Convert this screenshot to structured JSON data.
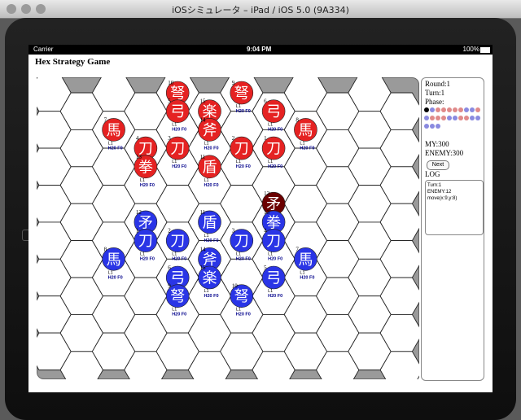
{
  "window_title": "iOSシミュレータ – iPad / iOS 5.0 (9A334)",
  "status": {
    "carrier": "Carrier",
    "time": "9:04 PM",
    "battery": "100%"
  },
  "app_title": "Hex Strategy Game",
  "sidebar": {
    "round": "Round:1",
    "turn": "Turn:1",
    "phase": "Phase:",
    "my": "MY:300",
    "enemy": "ENEMY:300",
    "next": "Next",
    "log_label": "LOG",
    "log_lines": [
      "Turn:1",
      "ENEMY:12",
      "move(x:9,y:8)"
    ]
  },
  "colors": {
    "red": "#e52222",
    "blue": "#2a35e6",
    "dark": "#6b0000",
    "board_bg": "#9a9a9a"
  },
  "phase_dots": [
    "dark",
    "blue",
    "red",
    "red",
    "red",
    "red",
    "red",
    "blue",
    "blue",
    "red",
    "blue",
    "red",
    "red",
    "red",
    "blue",
    "blue",
    "red",
    "red",
    "blue",
    "blue",
    "blue",
    "blue",
    "blue"
  ],
  "unit_stat": {
    "level": "L1",
    "hp": "H20 F0"
  },
  "units": [
    {
      "col": 4,
      "row": 0,
      "side": "red",
      "kanji": "弩",
      "num": "10"
    },
    {
      "col": 6,
      "row": 0,
      "side": "red",
      "kanji": "弩",
      "num": "9"
    },
    {
      "col": 4,
      "row": 1,
      "side": "red",
      "kanji": "弓",
      "num": "5"
    },
    {
      "col": 5,
      "row": 1,
      "side": "red",
      "kanji": "楽",
      "num": "15"
    },
    {
      "col": 7,
      "row": 1,
      "side": "red",
      "kanji": "弓",
      "num": "6"
    },
    {
      "col": 2,
      "row": 2,
      "side": "red",
      "kanji": "馬",
      "num": "7"
    },
    {
      "col": 5,
      "row": 2,
      "side": "red",
      "kanji": "斧",
      "num": "14"
    },
    {
      "col": 8,
      "row": 2,
      "side": "red",
      "kanji": "馬",
      "num": "8"
    },
    {
      "col": 3,
      "row": 3,
      "side": "red",
      "kanji": "刀",
      "num": "4"
    },
    {
      "col": 4,
      "row": 3,
      "side": "red",
      "kanji": "刀",
      "num": "3"
    },
    {
      "col": 6,
      "row": 3,
      "side": "red",
      "kanji": "刀",
      "num": "2"
    },
    {
      "col": 7,
      "row": 3,
      "side": "red",
      "kanji": "刀",
      "num": "1"
    },
    {
      "col": 3,
      "row": 4,
      "side": "red",
      "kanji": "拳",
      "num": "13"
    },
    {
      "col": 5,
      "row": 4,
      "side": "red",
      "kanji": "盾",
      "num": "11"
    },
    {
      "col": 7,
      "row": 6,
      "side": "dark",
      "kanji": "矛",
      "num": "12"
    },
    {
      "col": 3,
      "row": 7,
      "side": "blue",
      "kanji": "矛",
      "num": "12"
    },
    {
      "col": 5,
      "row": 7,
      "side": "blue",
      "kanji": "盾",
      "num": "11"
    },
    {
      "col": 7,
      "row": 7,
      "side": "blue",
      "kanji": "拳",
      "num": "13"
    },
    {
      "col": 3,
      "row": 8,
      "side": "blue",
      "kanji": "刀",
      "num": "1"
    },
    {
      "col": 4,
      "row": 8,
      "side": "blue",
      "kanji": "刀",
      "num": "2"
    },
    {
      "col": 6,
      "row": 8,
      "side": "blue",
      "kanji": "刀",
      "num": "3"
    },
    {
      "col": 7,
      "row": 8,
      "side": "blue",
      "kanji": "刀",
      "num": "4"
    },
    {
      "col": 2,
      "row": 9,
      "side": "blue",
      "kanji": "馬",
      "num": "8"
    },
    {
      "col": 5,
      "row": 9,
      "side": "blue",
      "kanji": "斧",
      "num": "14"
    },
    {
      "col": 8,
      "row": 9,
      "side": "blue",
      "kanji": "馬",
      "num": "7"
    },
    {
      "col": 4,
      "row": 10,
      "side": "blue",
      "kanji": "弓",
      "num": "6"
    },
    {
      "col": 5,
      "row": 10,
      "side": "blue",
      "kanji": "楽",
      "num": "15"
    },
    {
      "col": 7,
      "row": 10,
      "side": "blue",
      "kanji": "弓",
      "num": "5"
    },
    {
      "col": 4,
      "row": 11,
      "side": "blue",
      "kanji": "弩",
      "num": "9"
    },
    {
      "col": 6,
      "row": 11,
      "side": "blue",
      "kanji": "弩",
      "num": "10"
    }
  ]
}
